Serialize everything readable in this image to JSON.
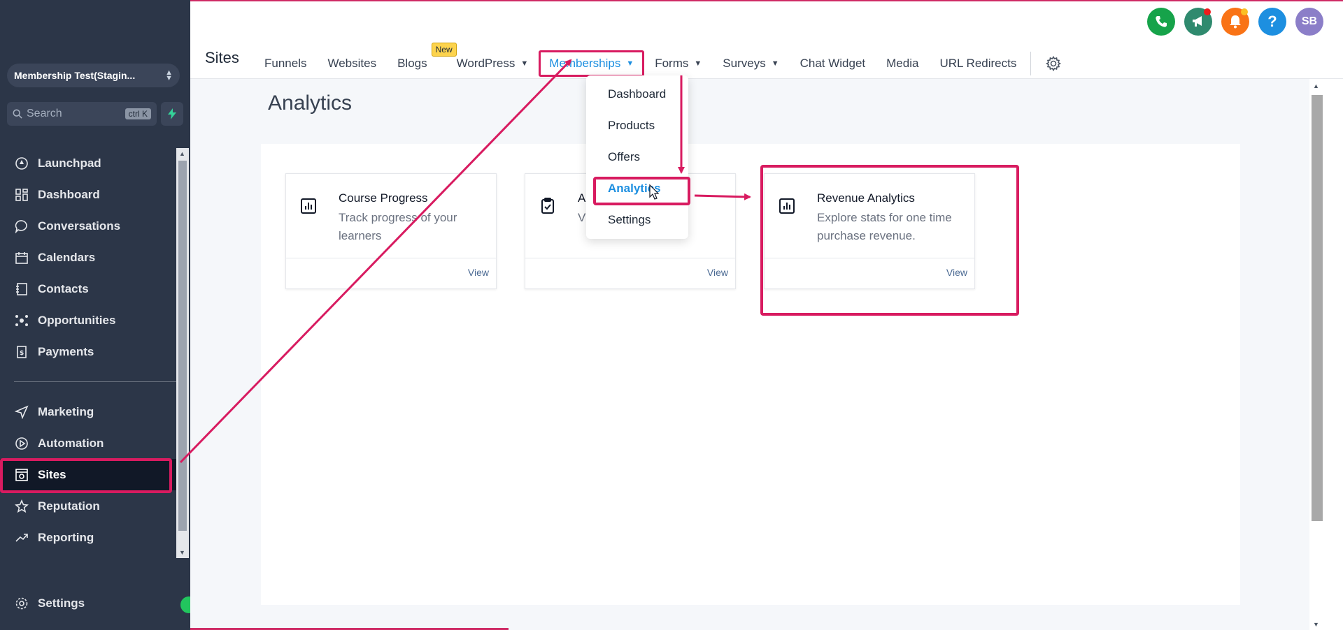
{
  "account": {
    "name": "Membership Test(Stagin..."
  },
  "search": {
    "placeholder": "Search",
    "shortcut": "ctrl K"
  },
  "sidebar": {
    "items": [
      {
        "label": "Launchpad",
        "icon": "rocket-icon"
      },
      {
        "label": "Dashboard",
        "icon": "grid-icon"
      },
      {
        "label": "Conversations",
        "icon": "chat-bubble-icon"
      },
      {
        "label": "Calendars",
        "icon": "calendar-icon"
      },
      {
        "label": "Contacts",
        "icon": "contact-book-icon"
      },
      {
        "label": "Opportunities",
        "icon": "network-icon"
      },
      {
        "label": "Payments",
        "icon": "receipt-icon"
      }
    ],
    "items2": [
      {
        "label": "Marketing",
        "icon": "send-icon"
      },
      {
        "label": "Automation",
        "icon": "play-circle-icon"
      },
      {
        "label": "Sites",
        "icon": "globe-window-icon",
        "active": true
      },
      {
        "label": "Reputation",
        "icon": "star-icon"
      },
      {
        "label": "Reporting",
        "icon": "trend-line-icon"
      }
    ],
    "settings_label": "Settings"
  },
  "header": {
    "title": "Sites",
    "tabs": [
      {
        "label": "Funnels"
      },
      {
        "label": "Websites"
      },
      {
        "label": "Blogs",
        "badge": "New"
      },
      {
        "label": "WordPress",
        "dropdown": true
      },
      {
        "label": "Memberships",
        "dropdown": true,
        "active": true
      },
      {
        "label": "Forms",
        "dropdown": true
      },
      {
        "label": "Surveys",
        "dropdown": true
      },
      {
        "label": "Chat Widget"
      },
      {
        "label": "Media"
      },
      {
        "label": "URL Redirects"
      }
    ],
    "avatar_initials": "SB",
    "help_label": "?"
  },
  "memberships_menu": {
    "items": [
      "Dashboard",
      "Products",
      "Offers",
      "Analytics",
      "Settings"
    ],
    "active": "Analytics"
  },
  "main": {
    "title": "Analytics",
    "cards": [
      {
        "title": "Course Progress",
        "desc": "Track progress of your learners",
        "action": "View",
        "icon": "bar-chart-icon"
      },
      {
        "title": "A",
        "desc": "Vi                     sults",
        "action": "View",
        "icon": "clipboard-check-icon"
      },
      {
        "title": "Revenue Analytics",
        "desc": "Explore stats for one time purchase revenue.",
        "action": "View",
        "icon": "bar-chart-icon"
      }
    ]
  },
  "colors": {
    "sidebar_bg": "#2c3648",
    "accent": "#1d8fe0",
    "annotation": "#d81b60",
    "phone": "#16a34a",
    "megaphone": "#2f8a6e",
    "bell": "#f97316",
    "help": "#1d8fe0",
    "avatar": "#8b7ec8"
  }
}
